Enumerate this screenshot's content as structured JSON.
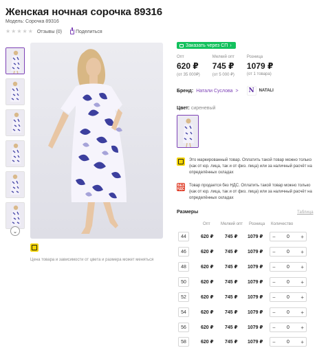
{
  "product": {
    "title": "Женская ночная сорочка 89316",
    "model": "Модель: Сорочка 89316",
    "reviews": "Отзывы (0)",
    "share": "Поделиться"
  },
  "gallery": {
    "more_label": "⌄",
    "price_note": "Цена товара и зависимости от цвета и размера может меняться"
  },
  "order_button": "Заказать через СП",
  "prices": [
    {
      "label": "Опт",
      "value": "620 ₽",
      "sub": "(от 35 000₽)"
    },
    {
      "label": "Мелкий опт",
      "value": "745 ₽",
      "sub": "(от 5 000 ₽)"
    },
    {
      "label": "Розница",
      "value": "1079 ₽",
      "sub": "(от 1 товара)"
    }
  ],
  "brand": {
    "label": "Бренд:",
    "value": "Натали Суслова",
    "chevron": ">",
    "logo_letter": "N",
    "logo_text": "NATALI"
  },
  "color": {
    "label": "Цвет:",
    "value": "сиреневый"
  },
  "notices": [
    {
      "icon": "",
      "text": "Это маркированный товар. Оплатить такой товар можно только (как от юр. лица, так и от физ. лица) или за наличный расчёт на определённых складах"
    },
    {
      "icon": "БЕЗ НДС",
      "text": "Товар продается без НДС. Оплатить такой товар можно только (как от юр. лица, так и от физ. лица) или за наличный расчёт на определённых складах"
    }
  ],
  "sizes": {
    "title": "Размеры",
    "table_link": "Таблица",
    "headers": [
      "Опт",
      "Мелкий опт",
      "Розница",
      "Количество"
    ],
    "rows": [
      {
        "size": "44",
        "opt": "620 ₽",
        "small": "745 ₽",
        "retail": "1079 ₽",
        "qty": "0"
      },
      {
        "size": "46",
        "opt": "620 ₽",
        "small": "745 ₽",
        "retail": "1079 ₽",
        "qty": "0"
      },
      {
        "size": "48",
        "opt": "620 ₽",
        "small": "745 ₽",
        "retail": "1079 ₽",
        "qty": "0"
      },
      {
        "size": "50",
        "opt": "620 ₽",
        "small": "745 ₽",
        "retail": "1079 ₽",
        "qty": "0"
      },
      {
        "size": "52",
        "opt": "620 ₽",
        "small": "745 ₽",
        "retail": "1079 ₽",
        "qty": "0"
      },
      {
        "size": "54",
        "opt": "620 ₽",
        "small": "745 ₽",
        "retail": "1079 ₽",
        "qty": "0"
      },
      {
        "size": "56",
        "opt": "620 ₽",
        "small": "745 ₽",
        "retail": "1079 ₽",
        "qty": "0"
      },
      {
        "size": "58",
        "opt": "620 ₽",
        "small": "745 ₽",
        "retail": "1079 ₽",
        "qty": "0"
      }
    ],
    "minus": "−",
    "plus": "+"
  },
  "colors": {
    "accent": "#7b3fb5",
    "green": "#13c15d",
    "yellow": "#f5d400",
    "red": "#e0402b"
  }
}
